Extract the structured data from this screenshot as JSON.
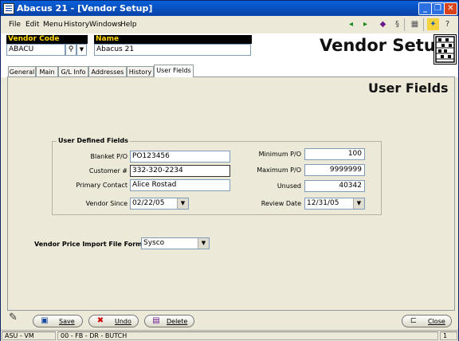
{
  "window": {
    "title": "Abacus 21 - [Vendor Setup]",
    "min": "_",
    "restore": "❐",
    "close": "✕"
  },
  "menu": [
    "File",
    "Edit",
    "Menu",
    "History",
    "Windows",
    "Help"
  ],
  "header": {
    "vendor_code_label": "Vendor Code",
    "vendor_code_value": "ABACU",
    "name_label": "Name",
    "name_value": "Abacus 21",
    "page_title": "Vendor Setup"
  },
  "tabs": [
    "General",
    "Main",
    "G/L Info",
    "Addresses",
    "History",
    "User Fields"
  ],
  "active_tab": "User Fields",
  "panel_title": "User Fields",
  "group": {
    "title": "User Defined Fields",
    "blanket_po_label": "Blanket P/O",
    "blanket_po_value": "PO123456",
    "customer_no_label": "Customer #",
    "customer_no_value": "332-320-2234",
    "primary_contact_label": "Primary Contact",
    "primary_contact_value": "Alice Rostad",
    "vendor_since_label": "Vendor Since",
    "vendor_since_value": "02/22/05",
    "minimum_po_label": "Minimum P/O",
    "minimum_po_value": "100",
    "maximum_po_label": "Maximum P/O",
    "maximum_po_value": "9999999",
    "unused_label": "Unused",
    "unused_value": "40342",
    "review_date_label": "Review Date",
    "review_date_value": "12/31/05"
  },
  "price_import": {
    "label": "Vendor Price Import File Format",
    "value": "Sysco"
  },
  "buttons": {
    "save": "Save",
    "undo": "Undo",
    "delete": "Delete",
    "close": "Close"
  },
  "status": {
    "user": "ASU - VM",
    "info": "00 - FB - DR - BUTCH",
    "page": "1"
  }
}
